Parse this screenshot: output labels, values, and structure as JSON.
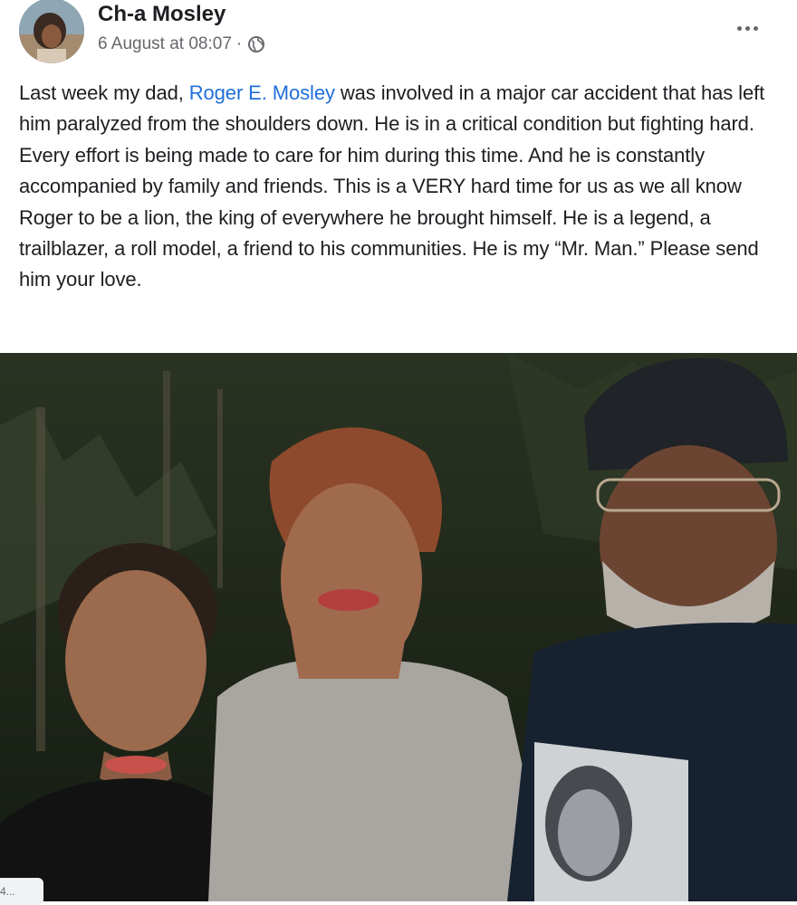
{
  "post": {
    "author": "Ch-a Mosley",
    "timestamp": "6 August at 08:07",
    "separator": "·",
    "audience_icon": "globe-icon",
    "more_icon": "more-options-icon",
    "text_before": "Last week my dad, ",
    "mention": "Roger E. Mosley",
    "text_after": " was involved in a major car accident that has left him paralyzed from the shoulders down. He is in a critical condition but fighting hard. Every effort is being made to care for him during this time. And he is constantly accompanied by family and friends. This is a VERY hard time for us as we all know Roger to be a lion, the king of everywhere he brought himself. He is a legend, a trailblazer, a roll model, a friend to his communities. He is my “Mr. Man.” Please send him your love.",
    "photo_corner_text": "4..."
  },
  "colors": {
    "link": "#216fdb",
    "secondary_text": "#65676b",
    "primary_text": "#1c1e21"
  }
}
